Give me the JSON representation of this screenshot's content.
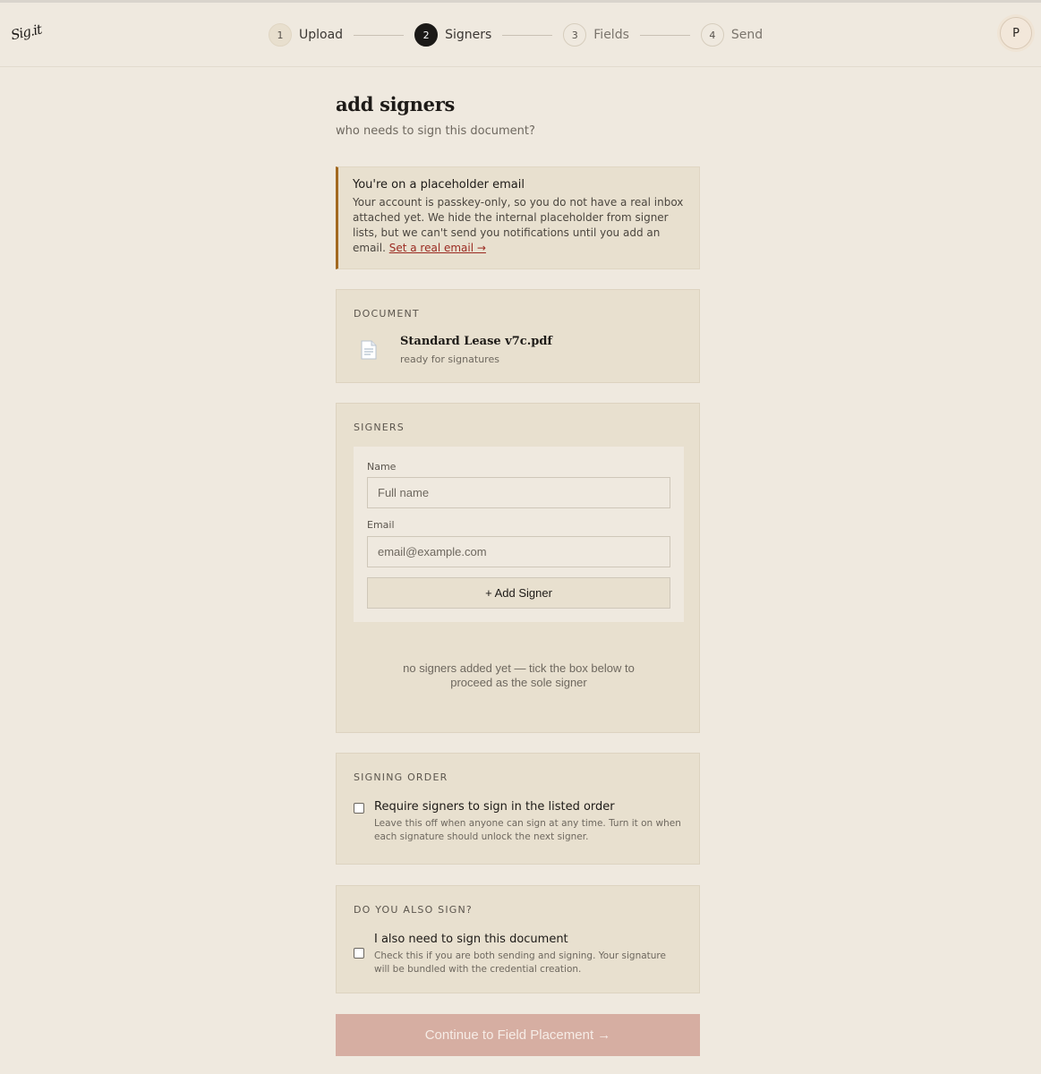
{
  "app": {
    "logo_text": "Sig.it"
  },
  "steps": [
    {
      "number": "1",
      "label": "Upload",
      "state": "done"
    },
    {
      "number": "2",
      "label": "Signers",
      "state": "active"
    },
    {
      "number": "3",
      "label": "Fields",
      "state": "upcoming"
    },
    {
      "number": "4",
      "label": "Send",
      "state": "upcoming"
    }
  ],
  "user": {
    "avatar_initial": "P"
  },
  "page": {
    "title": "add signers",
    "subtitle": "who needs to sign this document?"
  },
  "notice": {
    "title": "You're on a placeholder email",
    "body": "Your account is passkey-only, so you do not have a real inbox attached yet. We hide the internal placeholder from signer lists, but we can't send you notifications until you add an email. ",
    "link_text": "Set a real email →",
    "accent_color": "#a2681f"
  },
  "document": {
    "section_title": "DOCUMENT",
    "icon": "document-icon",
    "filename": "Standard Lease v7c.pdf",
    "status": "ready for signatures"
  },
  "signers": {
    "section_title": "SIGNERS",
    "name_label": "Name",
    "name_placeholder": "Full name",
    "name_value": "",
    "email_label": "Email",
    "email_placeholder": "email@example.com",
    "email_value": "",
    "add_button": "+ Add Signer",
    "empty_message": "no signers added yet — tick the box below to proceed as the sole signer"
  },
  "signing_order": {
    "section_title": "SIGNING ORDER",
    "checked": false,
    "label": "Require signers to sign in the listed order",
    "description": "Leave this off when anyone can sign at any time. Turn it on when each signature should unlock the next signer."
  },
  "also_sign": {
    "section_title": "DO YOU ALSO SIGN?",
    "checked": false,
    "label": "I also need to sign this document",
    "description": "Check this if you are both sending and signing. Your signature will be bundled with the credential creation."
  },
  "continue_button": "Continue to Field Placement  →",
  "colors": {
    "background": "#efe9df",
    "card": "#e8e0cf",
    "primary_button": "#d6aea2",
    "link": "#9b2b22"
  }
}
